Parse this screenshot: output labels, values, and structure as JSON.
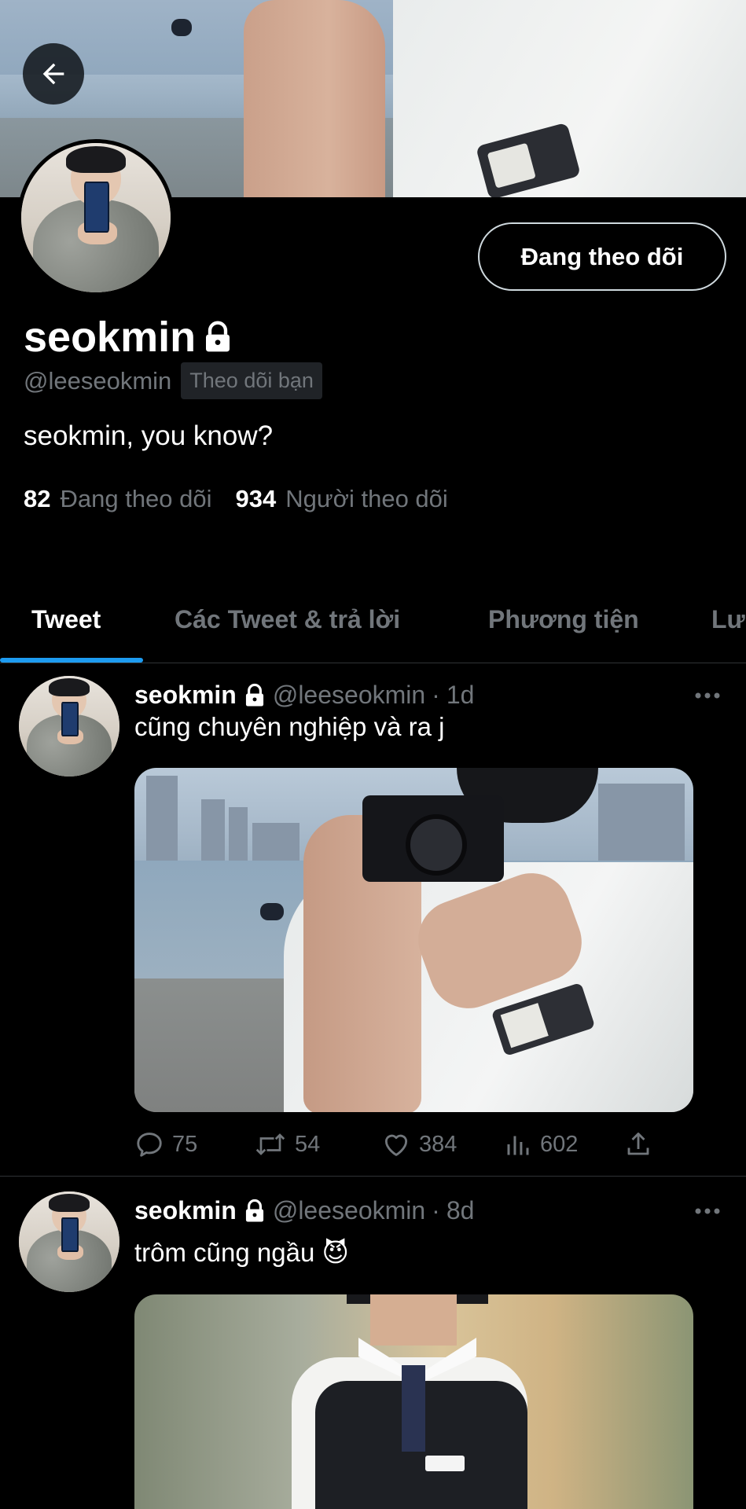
{
  "profile": {
    "display_name": "seokmin",
    "handle": "@leeseokmin",
    "follows_you": "Theo dõi bạn",
    "bio": "seokmin, you know?",
    "following_count": "82",
    "following_label": "Đang theo dõi",
    "followers_count": "934",
    "followers_label": "Người theo dõi",
    "follow_button": "Đang theo dõi",
    "protected": true
  },
  "tabs": [
    {
      "label": "Tweet",
      "active": true
    },
    {
      "label": "Các Tweet & trả lời",
      "active": false
    },
    {
      "label": "Phương tiện",
      "active": false
    },
    {
      "label": "Lượt thích",
      "active": false
    }
  ],
  "tweets": [
    {
      "name": "seokmin",
      "handle": "@leeseokmin",
      "time": "1d",
      "text": "cũng chuyên nghiệp và ra j",
      "replies": "75",
      "retweets": "54",
      "likes": "384",
      "views": "602"
    },
    {
      "name": "seokmin",
      "handle": "@leeseokmin",
      "time": "8d",
      "text": "trôm cũng ngầu 😈"
    }
  ],
  "icons": {
    "back": "arrow-left-icon",
    "lock": "lock-icon",
    "more": "more-horizontal-icon",
    "reply": "reply-icon",
    "retweet": "retweet-icon",
    "like": "heart-icon",
    "views": "views-icon",
    "share": "share-icon"
  },
  "colors": {
    "accent": "#1d9bf0",
    "background": "#000000",
    "muted": "#71767b"
  }
}
